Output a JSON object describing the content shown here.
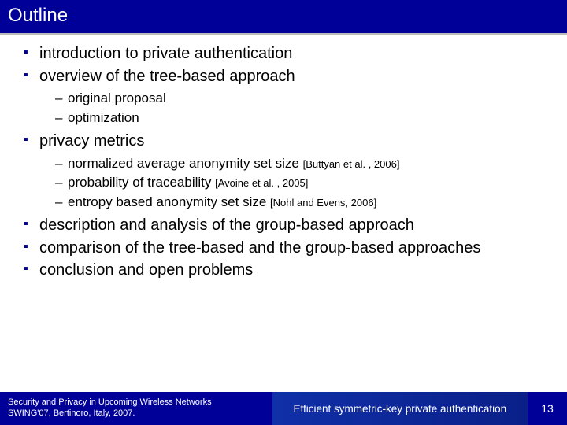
{
  "title": "Outline",
  "bullets": {
    "b1": "introduction to private authentication",
    "b2": "overview of the tree-based approach",
    "b2_sub": {
      "s1": "original proposal",
      "s2": "optimization"
    },
    "b3": "privacy metrics",
    "b3_sub": {
      "s1": "normalized average anonymity set size ",
      "s1_cite": "[Buttyan et al. , 2006]",
      "s2": "probability of traceability ",
      "s2_cite": "[Avoine et al. , 2005]",
      "s3": "entropy based anonymity set size ",
      "s3_cite": "[Nohl and Evens, 2006]"
    },
    "b4": "description and analysis of the group-based approach",
    "b5": "comparison of the tree-based and the group-based approaches",
    "b6": "conclusion and open problems"
  },
  "footer": {
    "left_line1": "Security and Privacy in Upcoming Wireless Networks",
    "left_line2": "SWING'07, Bertinoro, Italy, 2007.",
    "mid": "Efficient symmetric-key private authentication",
    "page": "13"
  }
}
